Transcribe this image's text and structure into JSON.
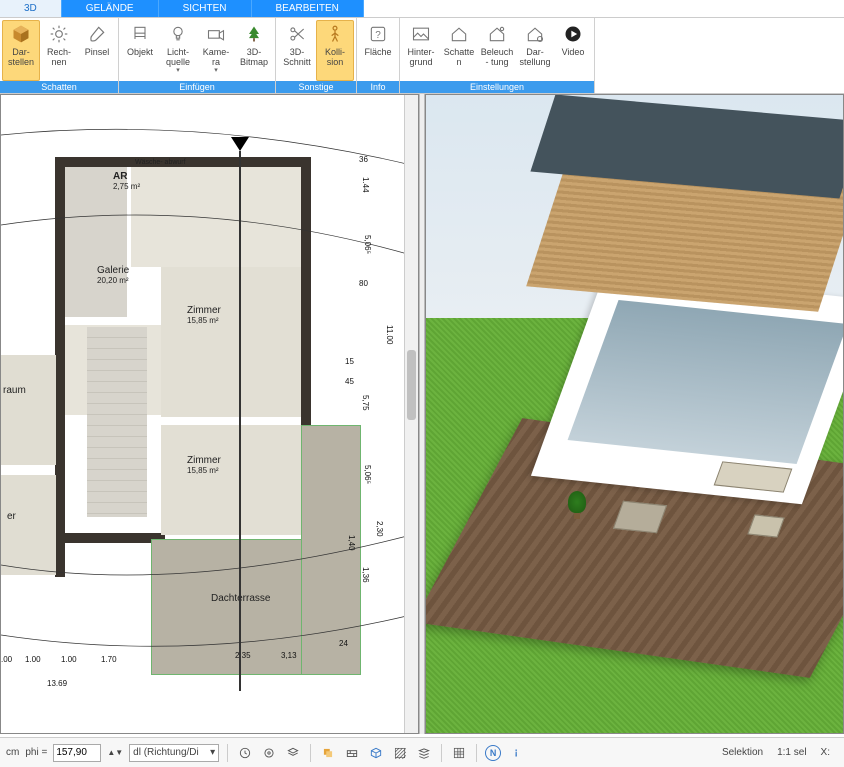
{
  "tabs": {
    "t0": "3D",
    "t1": "GELÄNDE",
    "t2": "SICHTEN",
    "t3": "BEARBEITEN"
  },
  "ribbon": {
    "g_schatten": "Schatten",
    "g_einfuegen": "Einfügen",
    "g_sonstige": "Sonstige",
    "g_info": "Info",
    "g_einstellungen": "Einstellungen",
    "darstellen": "Dar-\nstellen",
    "rechnen": "Rech-\nnen",
    "pinsel": "Pinsel",
    "objekt": "Objekt",
    "lichtquelle": "Licht-\nquelle",
    "kamera": "Kame-\nra",
    "bitmap3d": "3D-\nBitmap",
    "schnitt3d": "3D-\nSchnitt",
    "kollision": "Kolli-\nsion",
    "flaeche": "Fläche",
    "hintergrund": "Hinter-\ngrund",
    "schatten": "Schatten",
    "beleuchtung": "Beleuch-\ntung",
    "darstellung": "Dar-\nstellung",
    "video": "Video"
  },
  "plan": {
    "rooms": {
      "ar": {
        "name": "AR",
        "area": "2,75 m²",
        "note": "Wäsche-\nabwurf"
      },
      "galerie": {
        "name": "Galerie",
        "area": "20,20 m²"
      },
      "zimmer1": {
        "name": "Zimmer",
        "area": "15,85 m²"
      },
      "zimmer2": {
        "name": "Zimmer",
        "area": "15,85 m²"
      },
      "raum": {
        "name": "raum"
      },
      "er": {
        "name": "er"
      },
      "dachterrasse": {
        "name": "Dachterrasse"
      }
    },
    "dims": {
      "r1": "36",
      "r2": "1.44",
      "r3": "5,06⁵",
      "r4": "80",
      "r5": "11.00",
      "r6": "5,75",
      "r7": "15",
      "r8": "45",
      "r9": "5,06⁵",
      "r10": "2,30",
      "r11": "1,40",
      "r12": "1,36",
      "r13": "24",
      "b1": "1.00",
      "b2": "1.00",
      "b3": "1.70",
      "b4": "2.35",
      "b5": "3,13",
      "b6": "13.69",
      "b7": ".00"
    }
  },
  "status": {
    "unit": "cm",
    "philabel": "phi =",
    "phi": "157,90",
    "dl": "dl (Richtung/Di",
    "selektion": "Selektion",
    "scale": "1:1 sel",
    "xlabel": "X:"
  },
  "icons": {
    "darstellen": "cube",
    "rechnen": "sun",
    "pinsel": "brush",
    "objekt": "chair",
    "lichtquelle": "bulb",
    "kamera": "camera",
    "bitmap3d": "tree",
    "schnitt3d": "scissors",
    "kollision": "person",
    "flaeche": "question",
    "hintergrund": "image",
    "schatten": "house-shadow",
    "beleuchtung": "house-light",
    "darstellung": "house-gear",
    "video": "play"
  }
}
